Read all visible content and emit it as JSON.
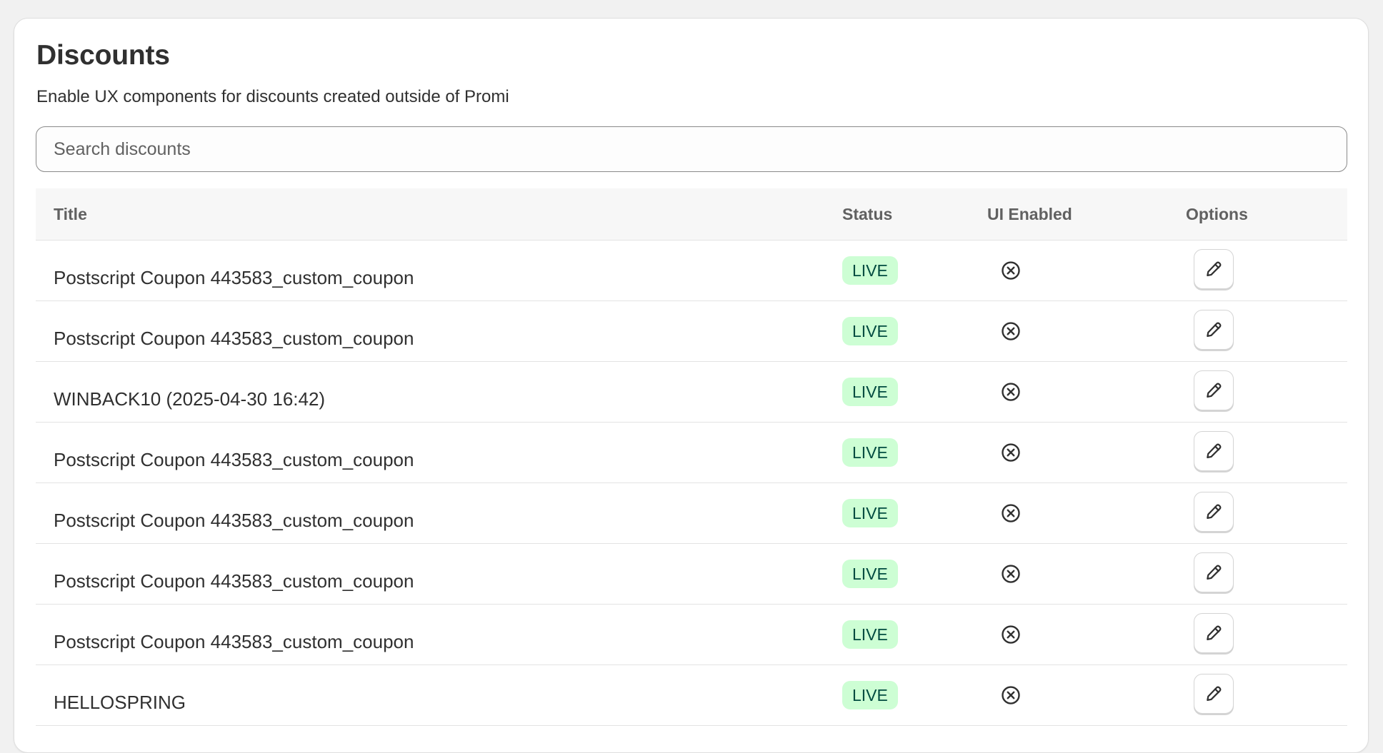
{
  "header": {
    "title": "Discounts",
    "subtitle": "Enable UX components for discounts created outside of Promi"
  },
  "search": {
    "placeholder": "Search discounts",
    "value": ""
  },
  "table": {
    "columns": [
      "Title",
      "Status",
      "UI Enabled",
      "Options"
    ],
    "rows": [
      {
        "title": "Postscript Coupon 443583_custom_coupon",
        "status": "LIVE",
        "ui_enabled": "x-circle-icon",
        "option": "edit-pencil-icon"
      },
      {
        "title": "Postscript Coupon 443583_custom_coupon",
        "status": "LIVE",
        "ui_enabled": "x-circle-icon",
        "option": "edit-pencil-icon"
      },
      {
        "title": "WINBACK10 (2025-04-30 16:42)",
        "status": "LIVE",
        "ui_enabled": "x-circle-icon",
        "option": "edit-pencil-icon"
      },
      {
        "title": "Postscript Coupon 443583_custom_coupon",
        "status": "LIVE",
        "ui_enabled": "x-circle-icon",
        "option": "edit-pencil-icon"
      },
      {
        "title": "Postscript Coupon 443583_custom_coupon",
        "status": "LIVE",
        "ui_enabled": "x-circle-icon",
        "option": "edit-pencil-icon"
      },
      {
        "title": "Postscript Coupon 443583_custom_coupon",
        "status": "LIVE",
        "ui_enabled": "x-circle-icon",
        "option": "edit-pencil-icon"
      },
      {
        "title": "Postscript Coupon 443583_custom_coupon",
        "status": "LIVE",
        "ui_enabled": "x-circle-icon",
        "option": "edit-pencil-icon"
      },
      {
        "title": "HELLOSPRING",
        "status": "LIVE",
        "ui_enabled": "x-circle-icon",
        "option": "edit-pencil-icon"
      }
    ]
  },
  "colors": {
    "live_badge_bg": "#cdfed4",
    "live_badge_text": "#014b40",
    "header_bg": "#f7f7f7",
    "page_bg": "#f1f1f1"
  }
}
